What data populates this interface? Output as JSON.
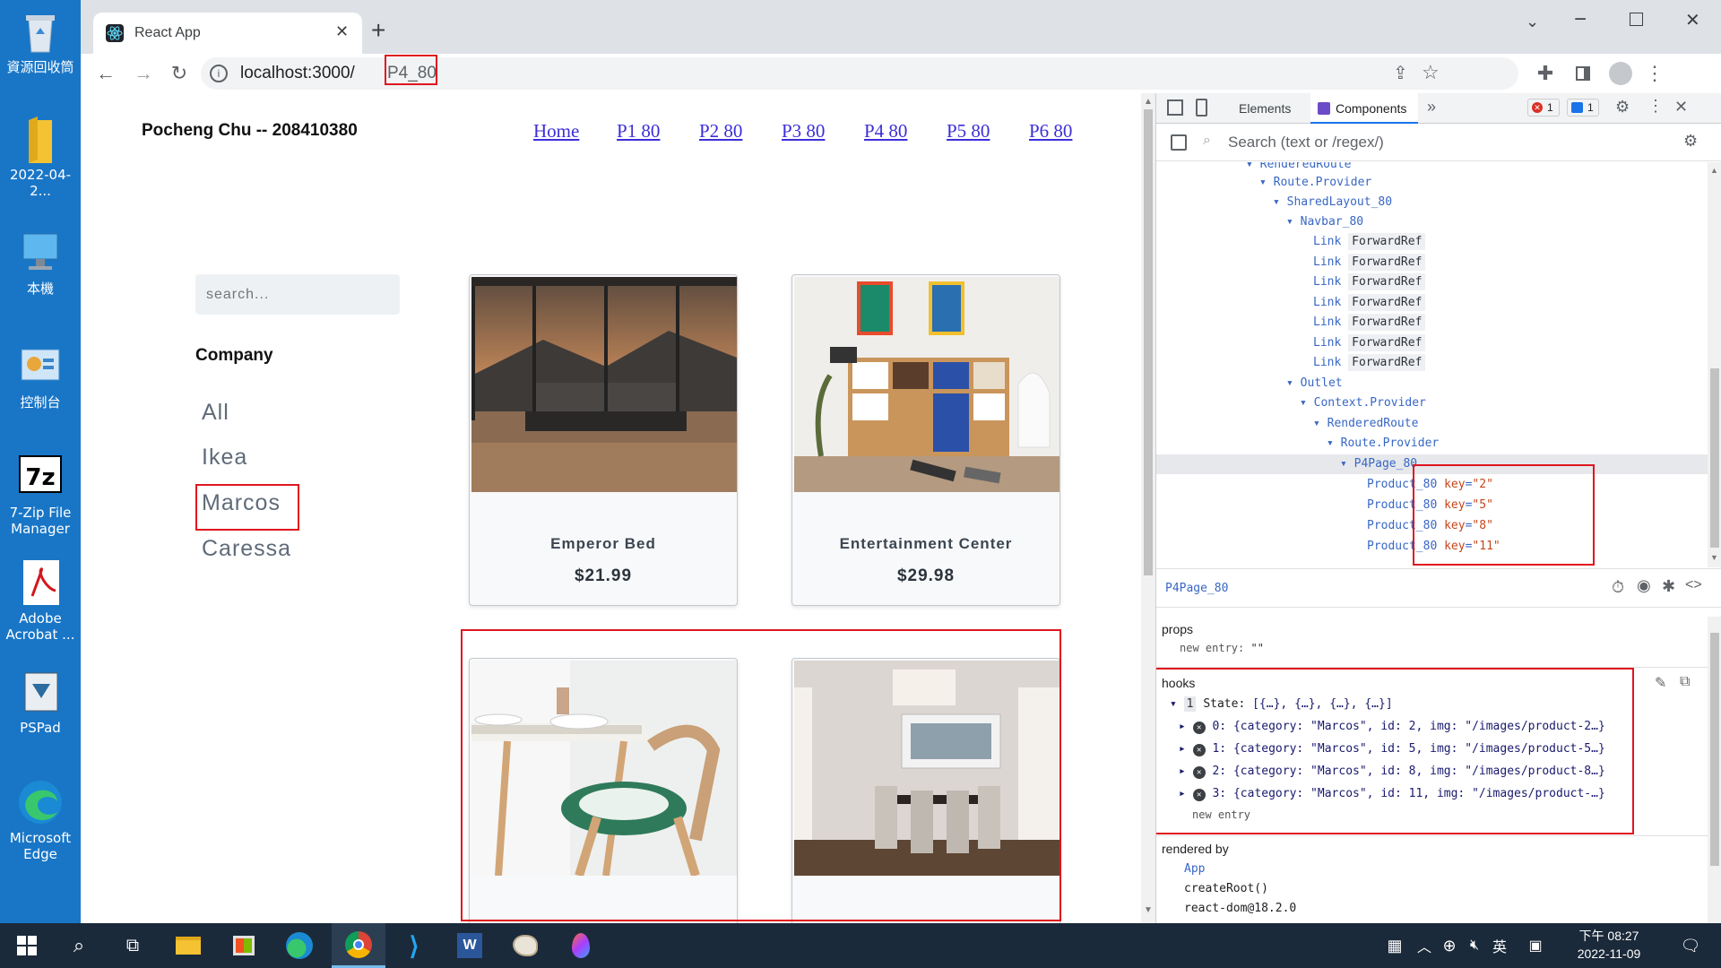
{
  "desktop": {
    "icons": [
      {
        "label": "資源回收筒"
      },
      {
        "label": "2022-04-2..."
      },
      {
        "label": "本機"
      },
      {
        "label": "控制台"
      },
      {
        "label": "7-Zip File Manager"
      },
      {
        "label": "Adobe Acrobat ..."
      },
      {
        "label": "PSPad"
      },
      {
        "label": "Microsoft Edge"
      }
    ]
  },
  "browser": {
    "tab_title": "React App",
    "url_host": "localhost:3000/",
    "url_path": "P4_80"
  },
  "page": {
    "brand": "Pocheng Chu -- 208410380",
    "nav": [
      "Home",
      "P1 80",
      "P2 80",
      "P3 80",
      "P4 80",
      "P5 80",
      "P6 80"
    ],
    "search_placeholder": "search...",
    "company_heading": "Company",
    "categories": [
      "All",
      "Ikea",
      "Marcos",
      "Caressa"
    ],
    "products": [
      {
        "name": "Emperor Bed",
        "price": "$21.99"
      },
      {
        "name": "Entertainment Center",
        "price": "$29.98"
      }
    ]
  },
  "devtools": {
    "tabs": {
      "elements": "Elements",
      "components": "Components"
    },
    "error_count": "1",
    "message_count": "1",
    "search_placeholder": "Search (text or /regex/)",
    "tree": {
      "rendered_route_top": "RenderedRoute",
      "route_provider": "Route.Provider",
      "shared_layout": "SharedLayout_80",
      "navbar": "Navbar_80",
      "link": "Link",
      "forward_ref": "ForwardRef",
      "outlet": "Outlet",
      "context_provider": "Context.Provider",
      "rendered_route": "RenderedRoute",
      "route_provider2": "Route.Provider",
      "p4page": "P4Page_80",
      "products": [
        {
          "name": "Product_80",
          "key_label": "key",
          "key_value": "\"2\""
        },
        {
          "name": "Product_80",
          "key_label": "key",
          "key_value": "\"5\""
        },
        {
          "name": "Product_80",
          "key_label": "key",
          "key_value": "\"8\""
        },
        {
          "name": "Product_80",
          "key_label": "key",
          "key_value": "\"11\""
        }
      ]
    },
    "selected_component": "P4Page_80",
    "props_title": "props",
    "props_new_entry": "new entry:",
    "props_new_entry_value": "\"\"",
    "hooks_title": "hooks",
    "state_index": "1",
    "state_label": "State:",
    "state_summary": "[{…}, {…}, {…}, {…}]",
    "state_items": [
      "0: {category: \"Marcos\", id: 2, img: \"/images/product-2…}",
      "1: {category: \"Marcos\", id: 5, img: \"/images/product-5…}",
      "2: {category: \"Marcos\", id: 8, img: \"/images/product-8…}",
      "3: {category: \"Marcos\", id: 11, img: \"/images/product-…}"
    ],
    "hooks_new_entry": "new entry",
    "rendered_by_title": "rendered by",
    "rendered_by": [
      "App",
      "createRoot()",
      "react-dom@18.2.0"
    ]
  },
  "taskbar": {
    "time": "下午 08:27",
    "date": "2022-11-09",
    "ime": "英"
  },
  "colors": {
    "highlight_red": "#e0161e",
    "link_blue": "#3c2fd8",
    "react_tree_blue": "#3867c5"
  }
}
